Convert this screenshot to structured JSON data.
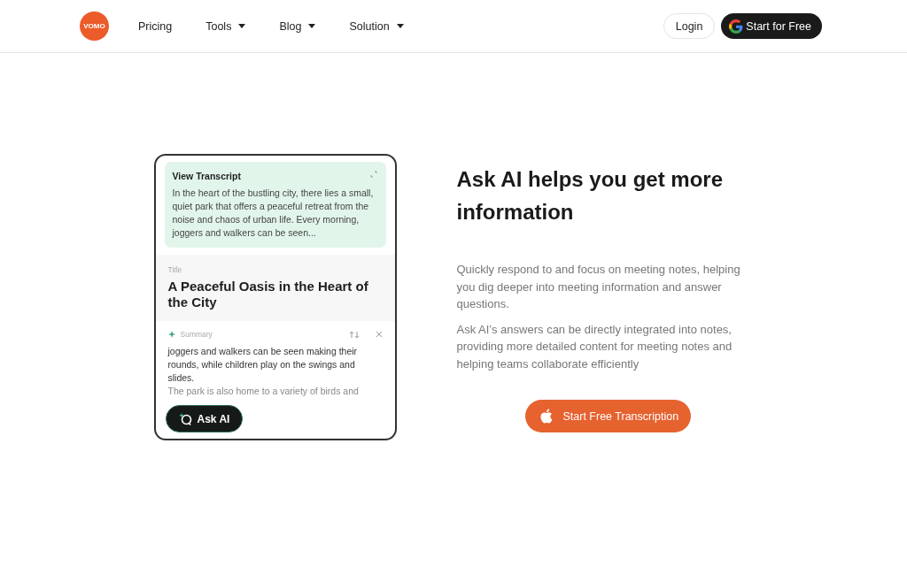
{
  "header": {
    "logo": "VOMO",
    "nav": [
      {
        "label": "Pricing",
        "dropdown": false
      },
      {
        "label": "Tools",
        "dropdown": true
      },
      {
        "label": "Blog",
        "dropdown": true
      },
      {
        "label": "Solution",
        "dropdown": true
      }
    ],
    "login": "Login",
    "cta": "Start for Free"
  },
  "card": {
    "transcript": {
      "heading": "View Transcript",
      "text": "In the heart of the bustling city, there lies a small, quiet park that offers a peaceful retreat from the noise and chaos of urban life. Every morning, joggers and walkers can be seen..."
    },
    "title_label": "Title",
    "title": "A Peaceful Oasis in the Heart of the City",
    "summary": {
      "label": "Summary",
      "lines": [
        "joggers and walkers can be seen making their rounds, while children play on the swings and slides.",
        "The park is also home to a variety of birds and"
      ]
    },
    "ask_button": "Ask AI"
  },
  "hero": {
    "heading": "Ask AI helps you get more information",
    "paragraphs": [
      "Quickly respond to and focus on meeting notes, helping you dig deeper into meeting information and answer questions.",
      "Ask AI’s answers can be directly integrated into notes, providing more detailed content for meeting notes and helping teams collaborate efficiently"
    ],
    "button": "Start Free Transcription"
  }
}
